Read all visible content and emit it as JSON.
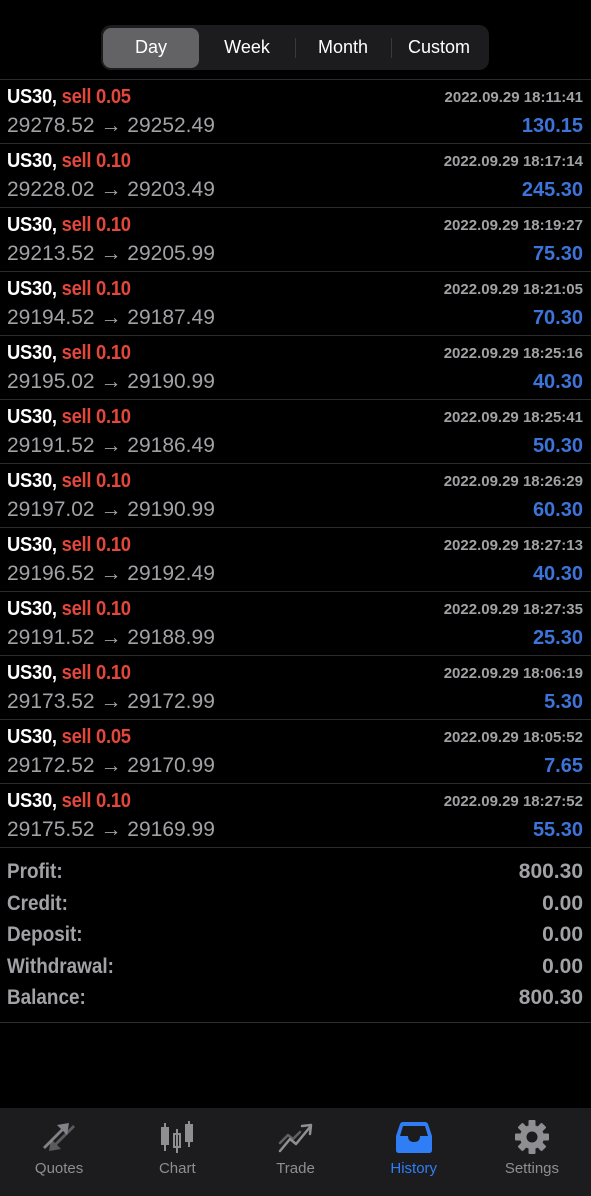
{
  "period_tabs": [
    {
      "label": "Day",
      "active": true
    },
    {
      "label": "Week",
      "active": false
    },
    {
      "label": "Month",
      "active": false
    },
    {
      "label": "Custom",
      "active": false
    }
  ],
  "trades": [
    {
      "symbol": "US30,",
      "side": "sell 0.05",
      "date": "2022.09.29 18:11:41",
      "open": "29278.52",
      "arrow": "→",
      "close": "29252.49",
      "profit": "130.15"
    },
    {
      "symbol": "US30,",
      "side": "sell 0.10",
      "date": "2022.09.29 18:17:14",
      "open": "29228.02",
      "arrow": "→",
      "close": "29203.49",
      "profit": "245.30"
    },
    {
      "symbol": "US30,",
      "side": "sell 0.10",
      "date": "2022.09.29 18:19:27",
      "open": "29213.52",
      "arrow": "→",
      "close": "29205.99",
      "profit": "75.30"
    },
    {
      "symbol": "US30,",
      "side": "sell 0.10",
      "date": "2022.09.29 18:21:05",
      "open": "29194.52",
      "arrow": "→",
      "close": "29187.49",
      "profit": "70.30"
    },
    {
      "symbol": "US30,",
      "side": "sell 0.10",
      "date": "2022.09.29 18:25:16",
      "open": "29195.02",
      "arrow": "→",
      "close": "29190.99",
      "profit": "40.30"
    },
    {
      "symbol": "US30,",
      "side": "sell 0.10",
      "date": "2022.09.29 18:25:41",
      "open": "29191.52",
      "arrow": "→",
      "close": "29186.49",
      "profit": "50.30"
    },
    {
      "symbol": "US30,",
      "side": "sell 0.10",
      "date": "2022.09.29 18:26:29",
      "open": "29197.02",
      "arrow": "→",
      "close": "29190.99",
      "profit": "60.30"
    },
    {
      "symbol": "US30,",
      "side": "sell 0.10",
      "date": "2022.09.29 18:27:13",
      "open": "29196.52",
      "arrow": "→",
      "close": "29192.49",
      "profit": "40.30"
    },
    {
      "symbol": "US30,",
      "side": "sell 0.10",
      "date": "2022.09.29 18:27:35",
      "open": "29191.52",
      "arrow": "→",
      "close": "29188.99",
      "profit": "25.30"
    },
    {
      "symbol": "US30,",
      "side": "sell 0.10",
      "date": "2022.09.29 18:06:19",
      "open": "29173.52",
      "arrow": "→",
      "close": "29172.99",
      "profit": "5.30"
    },
    {
      "symbol": "US30,",
      "side": "sell 0.05",
      "date": "2022.09.29 18:05:52",
      "open": "29172.52",
      "arrow": "→",
      "close": "29170.99",
      "profit": "7.65"
    },
    {
      "symbol": "US30,",
      "side": "sell 0.10",
      "date": "2022.09.29 18:27:52",
      "open": "29175.52",
      "arrow": "→",
      "close": "29169.99",
      "profit": "55.30"
    }
  ],
  "summary": [
    {
      "label": "Profit:",
      "value": "800.30"
    },
    {
      "label": "Credit:",
      "value": "0.00"
    },
    {
      "label": "Deposit:",
      "value": "0.00"
    },
    {
      "label": "Withdrawal:",
      "value": "0.00"
    },
    {
      "label": "Balance:",
      "value": "800.30"
    }
  ],
  "tabbar": [
    {
      "label": "Quotes",
      "icon": "quotes-icon",
      "active": false
    },
    {
      "label": "Chart",
      "icon": "candlestick-chart-icon",
      "active": false
    },
    {
      "label": "Trade",
      "icon": "trade-trend-icon",
      "active": false
    },
    {
      "label": "History",
      "icon": "history-inbox-icon",
      "active": true
    },
    {
      "label": "Settings",
      "icon": "gear-icon",
      "active": false
    }
  ],
  "colors": {
    "sell": "#e3473c",
    "profit": "#3d74d9",
    "muted": "#a2a2a6",
    "tab_active": "#2f7ef6",
    "tab_inactive": "#8e8e93"
  }
}
